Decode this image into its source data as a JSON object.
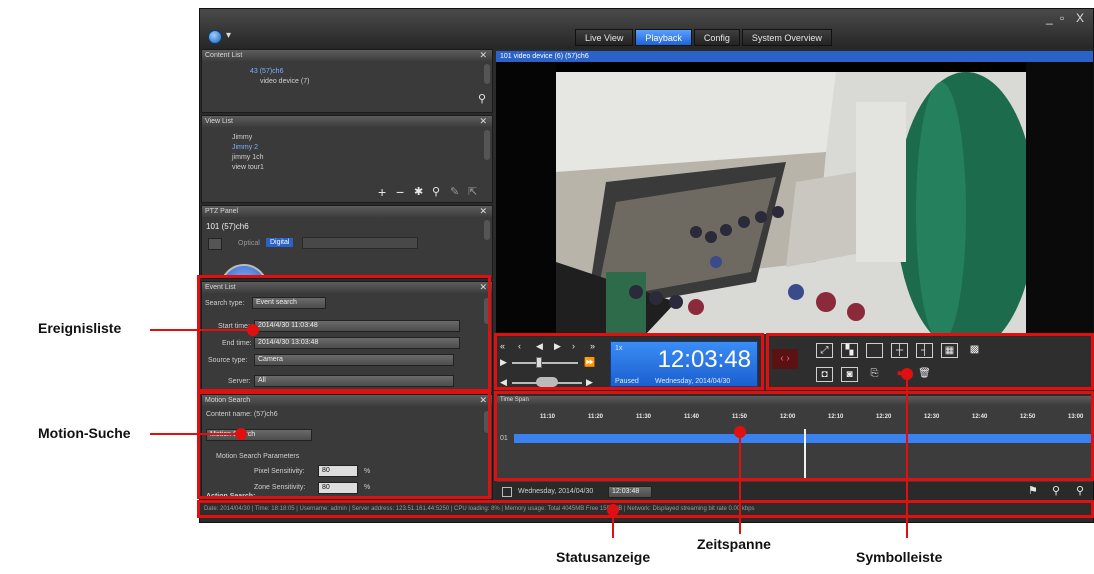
{
  "window": {
    "tabs": [
      {
        "label": "Live View",
        "active": false
      },
      {
        "label": "Playback",
        "active": true
      },
      {
        "label": "Config",
        "active": false
      },
      {
        "label": "System Overview",
        "active": false
      }
    ],
    "minimize": "_",
    "restore": "▫",
    "close": "X"
  },
  "content_list": {
    "title": "Content List",
    "item1": "43  (57)ch6",
    "item2": "video device (7)"
  },
  "view_list": {
    "title": "View List",
    "items": [
      "Jimmy",
      "Jimmy 2",
      "jimmy 1ch",
      "view tour1"
    ]
  },
  "ptz": {
    "title": "PTZ Panel",
    "device": "101  (57)ch6",
    "optical": "Optical",
    "digital": "Digital"
  },
  "event_list": {
    "title": "Event List",
    "search_type_label": "Search type:",
    "search_type_value": "Event search",
    "start_label": "Start time:",
    "start_value": "2014/4/30 11:03:48",
    "end_label": "End time:",
    "end_value": "2014/4/30 13:03:48",
    "source_label": "Source type:",
    "source_value": "Camera",
    "server_label": "Server:",
    "server_value": "All"
  },
  "motion_search": {
    "title": "Motion Search",
    "content_name": "Content name:  (57)ch6",
    "mode": "Motion Search",
    "params_title": "Motion Search Parameters",
    "pixel_label": "Pixel Sensitivity:",
    "pixel_value": "80",
    "zone_label": "Zone Sensitivity:",
    "zone_value": "80",
    "unit": "%",
    "action_label": "Action Search:"
  },
  "video": {
    "header": "101 video device (6)  (57)ch6"
  },
  "clock": {
    "time": "12:03:48",
    "state": "Paused",
    "date": "Wednesday, 2014/04/30",
    "speed": "1x"
  },
  "timeline": {
    "title": "Time Span",
    "ticks": [
      "11:10",
      "11:20",
      "11:30",
      "11:40",
      "11:50",
      "12:00",
      "12:10",
      "12:20",
      "12:30",
      "12:40",
      "12:50",
      "13:00"
    ],
    "track_label": "01",
    "footer_date": "Wednesday, 2014/04/30",
    "footer_time": "12:03:48"
  },
  "statusbar": {
    "text": "Date: 2014/04/30  |  Time: 18:18:05  |  Username: admin  |  Server address: 123.51.161.44:5250  |  CPU loading: 8%  |  Memory usage: Total 4045MB  Free 1558MB  |  Network: Displayed streaming bit rate    0.00 kbps"
  },
  "callouts": {
    "ereignisliste": "Ereignisliste",
    "motion_suche": "Motion-Suche",
    "statusanzeige": "Statusanzeige",
    "zeitspanne": "Zeitspanne",
    "symbolleiste": "Symbolleiste"
  },
  "colors": {
    "accent": "#2a62c8",
    "annotation": "#e01010",
    "timeline_bar": "#3b82f0"
  }
}
